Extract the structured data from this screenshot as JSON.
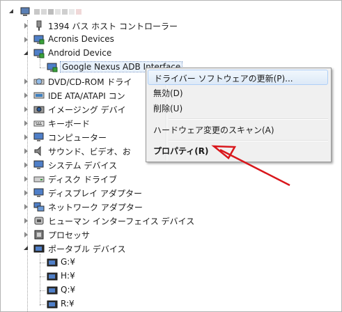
{
  "tree": {
    "root_label": "",
    "items": [
      {
        "label": "1394 バス ホスト コントローラー",
        "icon": "firewire-icon",
        "state": "collapsed"
      },
      {
        "label": "Acronis Devices",
        "icon": "monitor-icon",
        "state": "collapsed"
      },
      {
        "label": "Android Device",
        "icon": "monitor-icon",
        "state": "expanded"
      },
      {
        "label": "Google Nexus ADB Interface",
        "icon": "monitor-icon",
        "state": "child-selected"
      },
      {
        "label": "DVD/CD-ROM ドライ",
        "icon": "disc-drive-icon",
        "state": "collapsed"
      },
      {
        "label": "IDE ATA/ATAPI コン",
        "icon": "ide-controller-icon",
        "state": "collapsed"
      },
      {
        "label": "イメージング デバイ",
        "icon": "camera-icon",
        "state": "collapsed"
      },
      {
        "label": "キーボード",
        "icon": "keyboard-icon",
        "state": "collapsed"
      },
      {
        "label": "コンピューター",
        "icon": "computer-icon",
        "state": "collapsed"
      },
      {
        "label": "サウンド、ビデオ、お",
        "icon": "speaker-icon",
        "state": "collapsed"
      },
      {
        "label": "システム デバイス",
        "icon": "computer-icon",
        "state": "collapsed"
      },
      {
        "label": "ディスク ドライブ",
        "icon": "disk-drive-icon",
        "state": "collapsed"
      },
      {
        "label": "ディスプレイ アダプター",
        "icon": "display-adapter-icon",
        "state": "collapsed"
      },
      {
        "label": "ネットワーク アダプター",
        "icon": "network-adapter-icon",
        "state": "collapsed"
      },
      {
        "label": "ヒューマン インターフェイス デバイス",
        "icon": "hid-icon",
        "state": "collapsed"
      },
      {
        "label": "プロセッサ",
        "icon": "processor-icon",
        "state": "collapsed"
      },
      {
        "label": "ポータブル デバイス",
        "icon": "portable-device-icon",
        "state": "expanded"
      },
      {
        "label": "G:¥",
        "icon": "portable-device-icon",
        "state": "child"
      },
      {
        "label": "H:¥",
        "icon": "portable-device-icon",
        "state": "child"
      },
      {
        "label": "Q:¥",
        "icon": "portable-device-icon",
        "state": "child"
      },
      {
        "label": "R:¥",
        "icon": "portable-device-icon",
        "state": "child"
      }
    ]
  },
  "context_menu": {
    "items": [
      {
        "label": "ドライバー ソフトウェアの更新(P)...",
        "hover": true
      },
      {
        "label": "無効(D)"
      },
      {
        "label": "削除(U)"
      },
      {
        "label": "ハードウェア変更のスキャン(A)"
      },
      {
        "label": "プロパティ(R)",
        "bold": true
      }
    ]
  },
  "colors": {
    "arrow": "#d9171c",
    "menu_bg": "#f0f0f0",
    "hover_border": "#aecff7"
  }
}
